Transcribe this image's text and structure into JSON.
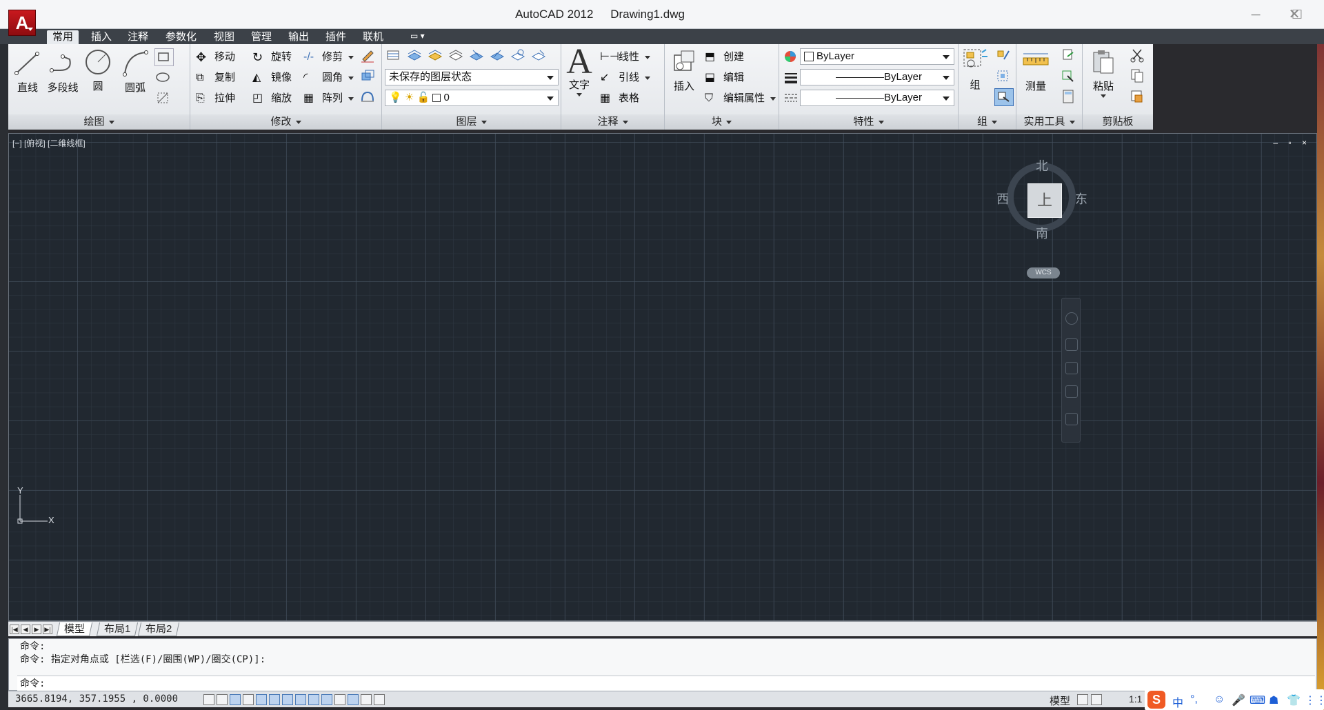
{
  "window": {
    "app": "AutoCAD 2012",
    "file": "Drawing1.dwg",
    "logo": "A"
  },
  "tabs": [
    "常用",
    "插入",
    "注释",
    "参数化",
    "视图",
    "管理",
    "输出",
    "插件",
    "联机"
  ],
  "active_tab": "常用",
  "panels": {
    "draw": {
      "title": "绘图",
      "line": "直线",
      "polyline": "多段线",
      "circle": "圆",
      "arc": "圆弧"
    },
    "modify": {
      "title": "修改",
      "move": "移动",
      "rotate": "旋转",
      "trim": "修剪",
      "copy": "复制",
      "mirror": "镜像",
      "fillet": "圆角",
      "stretch": "拉伸",
      "scale": "缩放",
      "array": "阵列"
    },
    "layers": {
      "title": "图层",
      "layer_state": "未保存的图层状态",
      "current_layer": "0"
    },
    "annotation": {
      "title": "注释",
      "text": "文字",
      "linear": "线性",
      "leader": "引线",
      "table": "表格"
    },
    "block": {
      "title": "块",
      "insert": "插入",
      "create": "创建",
      "edit": "编辑",
      "edit_attributes": "编辑属性"
    },
    "properties": {
      "title": "特性",
      "color": "ByLayer",
      "linetype": "ByLayer",
      "lineweight": "ByLayer"
    },
    "groups": {
      "title": "组",
      "group": "组"
    },
    "utilities": {
      "title": "实用工具",
      "measure": "测量"
    },
    "clipboard": {
      "title": "剪贴板",
      "paste": "粘贴"
    }
  },
  "viewport": {
    "label": "[−] [俯视] [二维线框]",
    "controls": "– ▫ ×"
  },
  "viewcube": {
    "north": "北",
    "south": "南",
    "east": "东",
    "west": "西",
    "face": "上",
    "wcs": "WCS"
  },
  "ucs": {
    "y": "Y",
    "x": "X"
  },
  "layout_tabs": [
    "模型",
    "布局1",
    "布局2"
  ],
  "command": {
    "lines": [
      "命令:",
      "命令: 指定对角点或 [栏选(F)/圈围(WP)/圈交(CP)]:"
    ],
    "prompt": "命令:"
  },
  "status": {
    "coords": "3665.8194, 357.1955 , 0.0000",
    "model": "模型",
    "annotation_scale": "1:1"
  },
  "ime": {
    "logo": "S",
    "lang": "中",
    "punct": "°,"
  },
  "colors": {
    "canvas": "#212830",
    "ribbon": "#e8ebef",
    "tabbar": "#3c4148",
    "accent": "#c9191e"
  }
}
